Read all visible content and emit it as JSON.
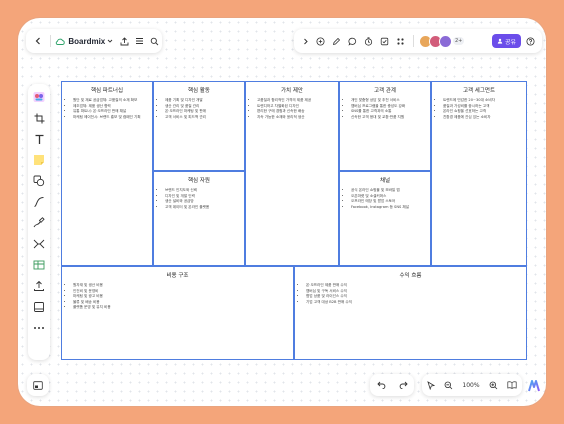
{
  "app": {
    "name": "Boardmix"
  },
  "toolbar": {
    "share_label": "공유",
    "collab_count": "2+"
  },
  "zoom": {
    "level": "100%"
  },
  "canvas": {
    "cells": {
      "partners": {
        "title": "핵심 파트너십",
        "items": [
          "원단 및 재료 공급업체: 고품질의 소재 확보",
          "제조업체: 제품 생산 협력",
          "유통 파트너: 온·오프라인 판매 채널",
          "마케팅 에이전시: 브랜드 홍보 및 캠페인 기획"
        ]
      },
      "activities": {
        "title": "핵심 활동",
        "items": [
          "제품 기획 및 디자인 개발",
          "생산 관리 및 품질 관리",
          "온·오프라인 마케팅 및 판매",
          "고객 서비스 및 피드백 관리"
        ]
      },
      "value": {
        "title": "가치 제안",
        "items": [
          "고품질과 합리적인 가격의 제품 제공",
          "트렌디하고 차별화된 디자인",
          "편리한 구매 경험과 신속한 배송",
          "지속 가능한 소재와 윤리적 생산"
        ]
      },
      "relationships": {
        "title": "고객 관계",
        "items": [
          "개인 맞춤형 상담 및 추천 서비스",
          "멤버십 프로그램을 통한 충성도 강화",
          "SNS를 통한 고객과의 소통",
          "신속한 고객 응대 및 교환·반품 지원"
        ]
      },
      "segments": {
        "title": "고객 세그먼트",
        "items": [
          "트렌드에 민감한 20~30대 소비자",
          "품질과 가성비를 중시하는 고객",
          "온라인 쇼핑을 선호하는 고객",
          "친환경 제품에 관심 있는 소비자"
        ]
      },
      "resources": {
        "title": "핵심 자원",
        "items": [
          "브랜드 인지도와 신뢰",
          "디자인 및 개발 인력",
          "생산 설비와 공급망",
          "고객 데이터 및 온라인 플랫폼"
        ]
      },
      "channels": {
        "title": "채널",
        "items": [
          "공식 온라인 쇼핑몰 및 모바일 앱",
          "오픈마켓 및 소셜커머스",
          "오프라인 매장 및 팝업 스토어",
          "Facebook, Instagram 등 SNS 채널"
        ]
      },
      "costs": {
        "title": "비용 구조",
        "items": [
          "원자재 및 생산 비용",
          "인건비 및 운영비",
          "마케팅 및 광고 비용",
          "물류 및 배송 비용",
          "플랫폼 운영 및 유지 비용"
        ]
      },
      "revenue": {
        "title": "수익 흐름",
        "items": [
          "온·오프라인 제품 판매 수익",
          "멤버십 및 구독 서비스 수익",
          "협업 상품 및 라이선스 수익",
          "기업 고객 대상 B2B 판매 수익"
        ]
      }
    }
  }
}
